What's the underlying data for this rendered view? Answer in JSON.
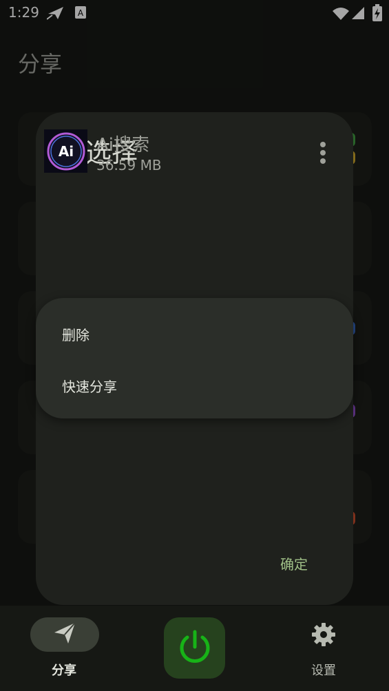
{
  "status_bar": {
    "time": "1:29",
    "icons": [
      "send-notification-icon",
      "text-app-icon",
      "wifi-icon",
      "cellular-signal-icon",
      "battery-charging-icon"
    ],
    "badge_letter": "A"
  },
  "page": {
    "title": "分享"
  },
  "dialog": {
    "title": "选择",
    "app": {
      "name": "Ai搜索",
      "size": "36.59 MB",
      "icon_text": "Ai"
    },
    "confirm_label": "确定"
  },
  "popup_menu": {
    "items": [
      {
        "label": "删除"
      },
      {
        "label": "快速分享"
      }
    ]
  },
  "bottom_nav": {
    "items": [
      {
        "label": "分享",
        "icon": "send-icon",
        "selected": true
      },
      {
        "label": "",
        "icon": "power-icon",
        "selected": false
      },
      {
        "label": "设置",
        "icon": "gear-icon",
        "selected": false
      }
    ]
  },
  "colors": {
    "background": "#161814",
    "dialog": "#1f211d",
    "popup": "#2b2e29",
    "accent_green": "#17b317",
    "confirm_text": "#9fbf87"
  }
}
